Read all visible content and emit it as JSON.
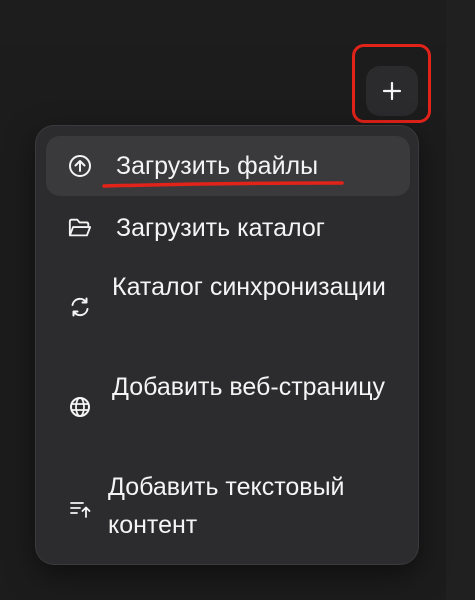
{
  "add_button": {
    "icon": "plus-icon"
  },
  "menu": {
    "items": [
      {
        "label": "Загрузить файлы",
        "icon": "upload-circle-icon",
        "highlighted": true
      },
      {
        "label": "Загрузить каталог",
        "icon": "folder-icon",
        "highlighted": false
      },
      {
        "label": "Каталог синхронизации",
        "icon": "sync-icon",
        "highlighted": false
      },
      {
        "label": "Добавить веб-страницу",
        "icon": "globe-icon",
        "highlighted": false
      },
      {
        "label": "Добавить текстовый контент",
        "icon": "add-text-icon",
        "highlighted": false
      }
    ]
  },
  "colors": {
    "annotation": "#e2231a",
    "menu_bg": "#2c2c2e",
    "highlight_bg": "#3a3a3c",
    "page_bg": "#1c1c1d"
  }
}
